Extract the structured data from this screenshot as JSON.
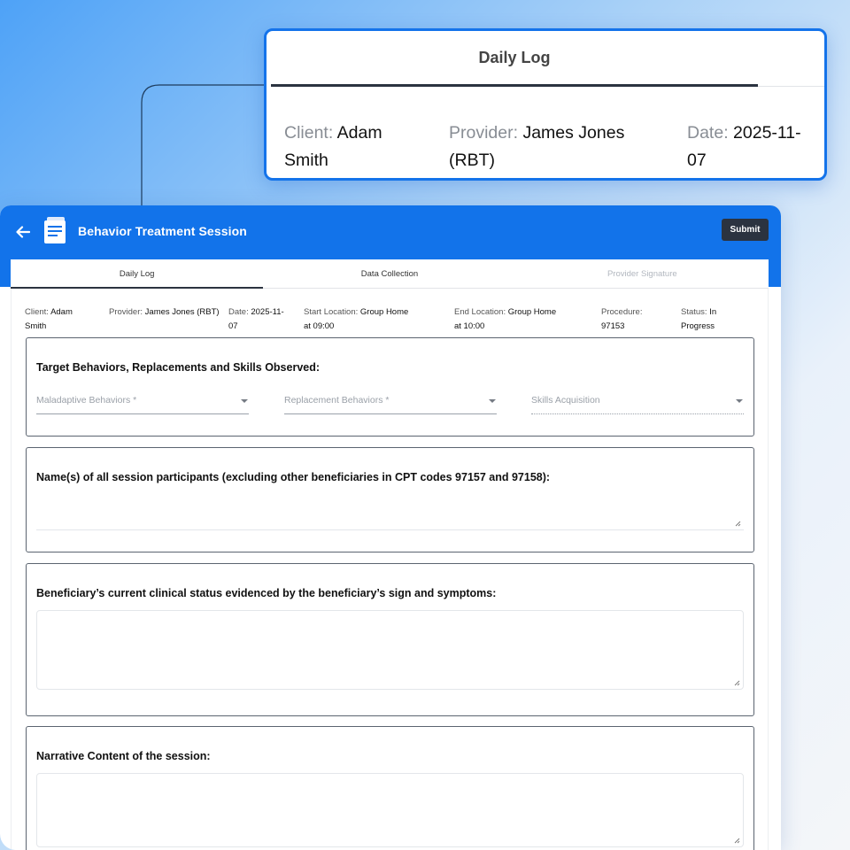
{
  "app": {
    "title": "Behavior Treatment Session",
    "submit_label": "Submit",
    "tabs": [
      {
        "label": "Daily Log",
        "state": "active"
      },
      {
        "label": "Data Collection",
        "state": "normal"
      },
      {
        "label": "Provider Signature",
        "state": "disabled"
      }
    ]
  },
  "session": {
    "client_label": "Client:",
    "client_value": "Adam Smith",
    "provider_label": "Provider:",
    "provider_value": "James Jones (RBT)",
    "date_label": "Date:",
    "date_value": "2025-11-07",
    "start_label": "Start Location:",
    "start_value": "Group Home at 09:00",
    "end_label": "End Location:",
    "end_value": "Group Home at 10:00",
    "procedure_label": "Procedure:",
    "procedure_value": "97153",
    "status_label": "Status:",
    "status_value": "In Progress"
  },
  "sections": {
    "behaviors": {
      "title": "Target Behaviors, Replacements and Skills Observed:",
      "maladaptive": "Maladaptive Behaviors *",
      "replacement": "Replacement Behaviors *",
      "skills": "Skills Acquisition"
    },
    "participants": {
      "title": "Name(s) of all session participants (excluding other beneficiaries in CPT codes 97157 and 97158):"
    },
    "clinical_status": {
      "title": "Beneficiary’s current clinical status evidenced by the beneficiary’s sign and symptoms:"
    },
    "narrative": {
      "title": "Narrative Content of the session:"
    }
  },
  "callout": {
    "tab_label": "Daily Log",
    "client_label": "Client:",
    "client_value": "Adam Smith",
    "provider_label": "Provider:",
    "provider_value": "James Jones (RBT)",
    "date_label": "Date:",
    "date_value": "2025-11-07"
  },
  "icons": {
    "back": "arrow-left-icon",
    "document": "document-stack-icon",
    "caret": "caret-down-icon",
    "resize": "resize-handle-icon"
  },
  "colors": {
    "brand_blue": "#1273ea",
    "dark": "#2b3340",
    "callout_border": "#1473ea"
  }
}
